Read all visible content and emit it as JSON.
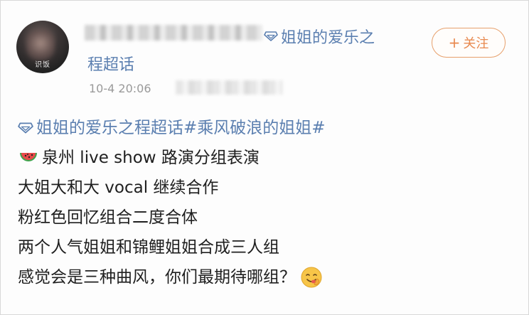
{
  "post": {
    "avatar_text": "识饭",
    "author_suffix": "姐姐的爱乐之",
    "author_line2": "程超话",
    "timestamp": "10-4 20:06",
    "follow_label": "关注",
    "topic_line": "姐姐的爱乐之程超话#乘风破浪的姐姐#",
    "lines": [
      "泉州 live show 路演分组表演",
      "大姐大和大 vocal 继续合作",
      "粉红色回忆组合二度合体",
      "两个人气姐姐和锦鲤姐姐合成三人组",
      "感觉会是三种曲风，你们最期待哪组？"
    ]
  },
  "icons": {
    "topic": "diamond-topic-icon",
    "watermelon": "watermelon-emoji",
    "yum": "yum-face-emoji"
  },
  "colors": {
    "link_blue": "#5b7fb0",
    "follow_orange": "#e8894f",
    "timestamp_gray": "#9a9a9a"
  }
}
